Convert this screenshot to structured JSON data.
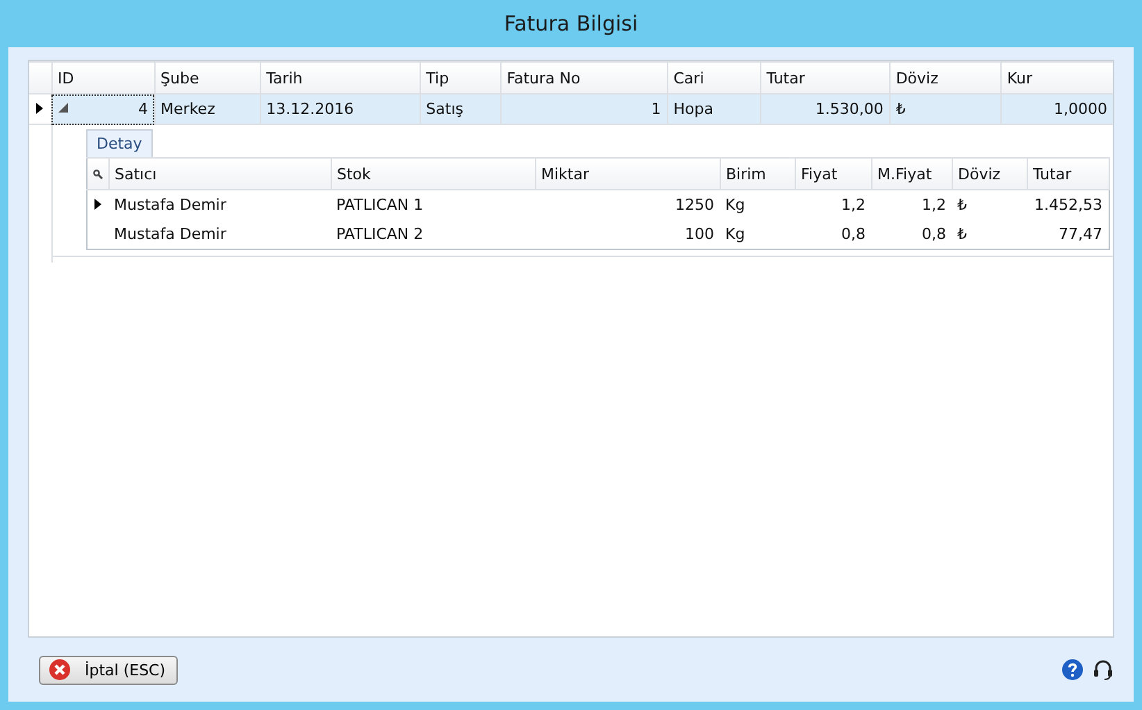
{
  "window": {
    "title": "Fatura Bilgisi"
  },
  "grid": {
    "columns": [
      {
        "label": "ID",
        "kind": "number"
      },
      {
        "label": "Şube",
        "kind": "text"
      },
      {
        "label": "Tarih",
        "kind": "text"
      },
      {
        "label": "Tip",
        "kind": "text"
      },
      {
        "label": "Fatura No",
        "kind": "number"
      },
      {
        "label": "Cari",
        "kind": "text"
      },
      {
        "label": "Tutar",
        "kind": "number"
      },
      {
        "label": "Döviz",
        "kind": "text"
      },
      {
        "label": "Kur",
        "kind": "number"
      }
    ],
    "rows": [
      {
        "selected": true,
        "expanded": true,
        "cells": [
          "4",
          "Merkez",
          "13.12.2016",
          "Satış",
          "1",
          "Hopa",
          "1.530,00",
          "₺",
          "1,0000"
        ],
        "detail": {
          "tabs": [
            {
              "label": "Detay",
              "selected": true
            }
          ],
          "columns": [
            {
              "label": "Satıcı",
              "kind": "text"
            },
            {
              "label": "Stok",
              "kind": "text"
            },
            {
              "label": "Miktar",
              "kind": "number"
            },
            {
              "label": "Birim",
              "kind": "text"
            },
            {
              "label": "Fiyat",
              "kind": "number"
            },
            {
              "label": "M.Fiyat",
              "kind": "number"
            },
            {
              "label": "Döviz",
              "kind": "text"
            },
            {
              "label": "Tutar",
              "kind": "number"
            }
          ],
          "rows": [
            {
              "selected": true,
              "cells": [
                "Mustafa Demir",
                "PATLICAN 1",
                "1250",
                "Kg",
                "1,2",
                "1,2",
                "₺",
                "1.452,53"
              ]
            },
            {
              "selected": false,
              "cells": [
                "Mustafa Demir",
                "PATLICAN 2",
                "100",
                "Kg",
                "0,8",
                "0,8",
                "₺",
                "77,47"
              ]
            }
          ]
        }
      }
    ]
  },
  "footer": {
    "cancel_button": "İptal (ESC)"
  }
}
